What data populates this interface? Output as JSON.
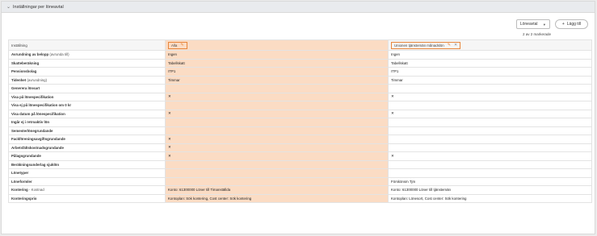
{
  "panel": {
    "title": "Inställningar per löneavtal",
    "chevron": "⌄"
  },
  "toolbar": {
    "select_value": "Löneavtal",
    "add_label": "Lägg till",
    "count_text": "2 av 2 markerade"
  },
  "columns": {
    "setting_header": "Inställning",
    "col1_header": "Alla",
    "col2_header": "Unionen tjänstemän månadslön"
  },
  "rows": [
    {
      "label": "Avrundning av belopp",
      "sub": " (avrunda till)",
      "c1": "Ingen",
      "c2": "Ingen"
    },
    {
      "label": "Skatteberäkning",
      "sub": "",
      "c1": "Tabellskatt",
      "c2": "Tabellskatt"
    },
    {
      "label": "Pensionsbolag",
      "sub": "",
      "c1": "ITP1",
      "c2": "ITP1"
    },
    {
      "label": "Tidenhet",
      "sub": " (avrundning)",
      "c1": "Timmar",
      "c2": "Timmar"
    },
    {
      "label": "Generera lönsart",
      "sub": "",
      "c1": "",
      "c2": ""
    },
    {
      "label": "Visa på lönespecifikation",
      "sub": "",
      "c1": "✕",
      "c2": "✕"
    },
    {
      "label": "Visa ej på lönespecifikation om 0 kr",
      "sub": "",
      "c1": "",
      "c2": ""
    },
    {
      "label": "Visa datum på lönespecifikation",
      "sub": "",
      "c1": "✕",
      "c2": "✕"
    },
    {
      "label": "Ingår ej i retroaktiv lön",
      "sub": "",
      "c1": "",
      "c2": ""
    },
    {
      "label": "Semesterlönegrundande",
      "sub": "",
      "c1": "",
      "c2": ""
    },
    {
      "label": "Fackföreningsavgiftsgrundande",
      "sub": "",
      "c1": "✕",
      "c2": ""
    },
    {
      "label": "Arbetsfältskostnadsgrundande",
      "sub": "",
      "c1": "✕",
      "c2": ""
    },
    {
      "label": "Pålagsgrundande",
      "sub": "",
      "c1": "✕",
      "c2": "✕"
    },
    {
      "label": "Beräkningsunderlag sjuklön",
      "sub": "",
      "c1": "",
      "c2": ""
    },
    {
      "label": "Lönetyper",
      "sub": "",
      "c1": "",
      "c2": ""
    },
    {
      "label": "Löneformler",
      "sub": "",
      "c1": "",
      "c2": "Förskönsm Tjm"
    },
    {
      "label": "Kontering",
      "sub": " - Kostnad",
      "c1": "Konto: 61300000 Löner till Timanställda",
      "c2": "Konto: 61300000 Löner till tjänstemän"
    },
    {
      "label": "Konteringsprio",
      "sub": "",
      "c1": "Kontoplan: Sök kontering, Cost center: Sök kontering",
      "c2": "Kontoplan: Lönesort, Cost center: Sök kontering"
    }
  ]
}
